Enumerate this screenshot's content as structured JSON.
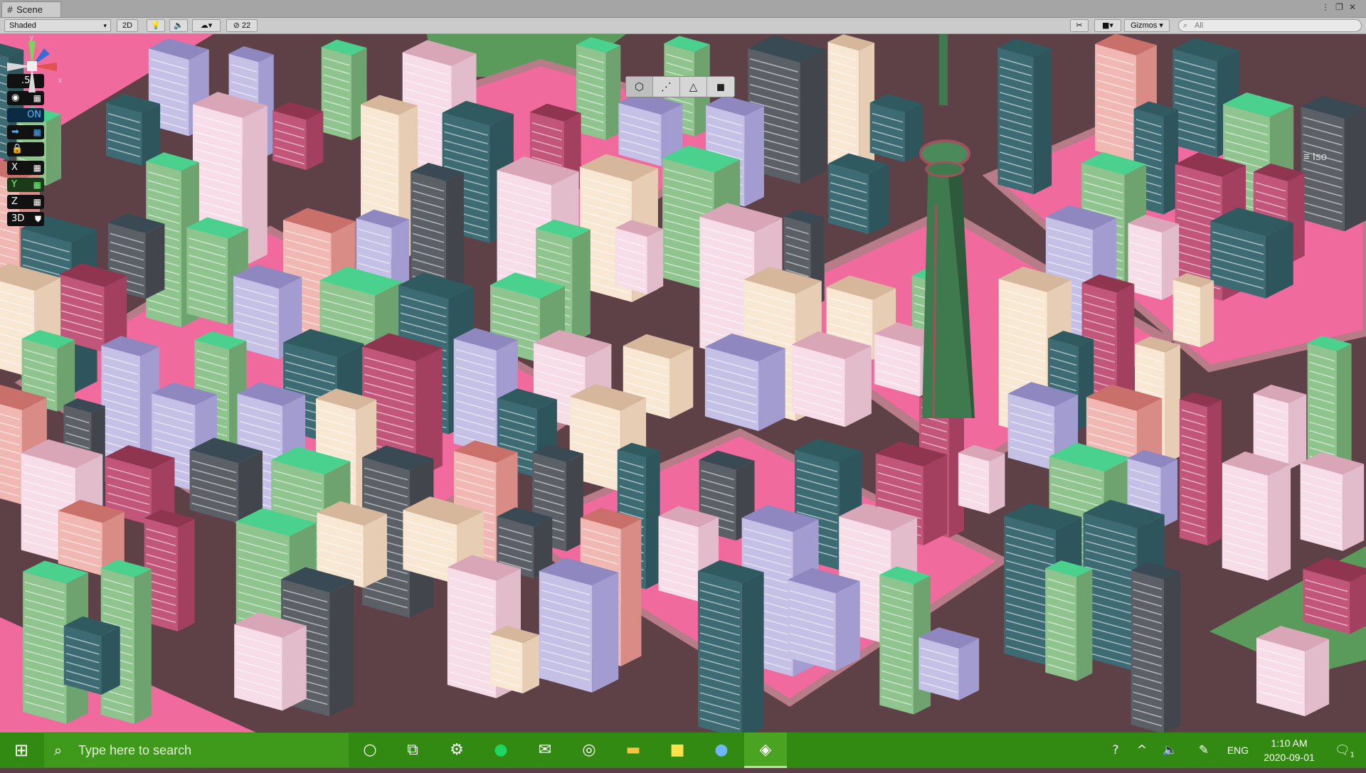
{
  "window": {
    "tab_label": "Scene",
    "controls": [
      "⋮",
      "❐",
      "✕"
    ]
  },
  "toolbar": {
    "shading_mode": "Shaded",
    "mode_2d": "2D",
    "hidden_count": "22",
    "gizmos_label": "Gizmos",
    "search_placeholder": "All"
  },
  "overlay": {
    "left_buttons": [
      {
        "label": ".5",
        "icon": "snap-increment-icon"
      },
      {
        "label": "",
        "icon": "visibility-eye-icon"
      },
      {
        "label": "ON",
        "icon": "toggle-icon"
      },
      {
        "label": "",
        "icon": "arrow-right-icon"
      },
      {
        "label": "",
        "icon": "lock-icon"
      },
      {
        "label": "X",
        "icon": "axis-x-grid-icon"
      },
      {
        "label": "Y",
        "icon": "axis-y-grid-icon"
      },
      {
        "label": "Z",
        "icon": "axis-z-grid-icon"
      },
      {
        "label": "3D",
        "icon": "shield-icon"
      }
    ],
    "tools": [
      "cube-icon",
      "vertex-icon",
      "edge-icon",
      "face-icon"
    ],
    "gizmo_axes": {
      "y": "y",
      "x": "x"
    },
    "projection": "Iso"
  },
  "taskbar": {
    "search_placeholder": "Type here to search",
    "apps": [
      "cortana-icon",
      "task-view-icon",
      "settings-icon",
      "spotify-icon",
      "mail-icon",
      "chrome-icon",
      "file-explorer-icon",
      "sticky-notes-icon",
      "zoom-icon",
      "unity-icon"
    ],
    "language": "ENG",
    "time": "1:10 AM",
    "date": "2020-09-01",
    "notification_count": "1"
  },
  "colors": {
    "ground_pink": "#f06a9e",
    "road": "#5e4147",
    "sidewalk": "#b87c88",
    "park": "#5a9a5a",
    "taskbar": "#338a12",
    "tower": "#3f7a4f"
  }
}
